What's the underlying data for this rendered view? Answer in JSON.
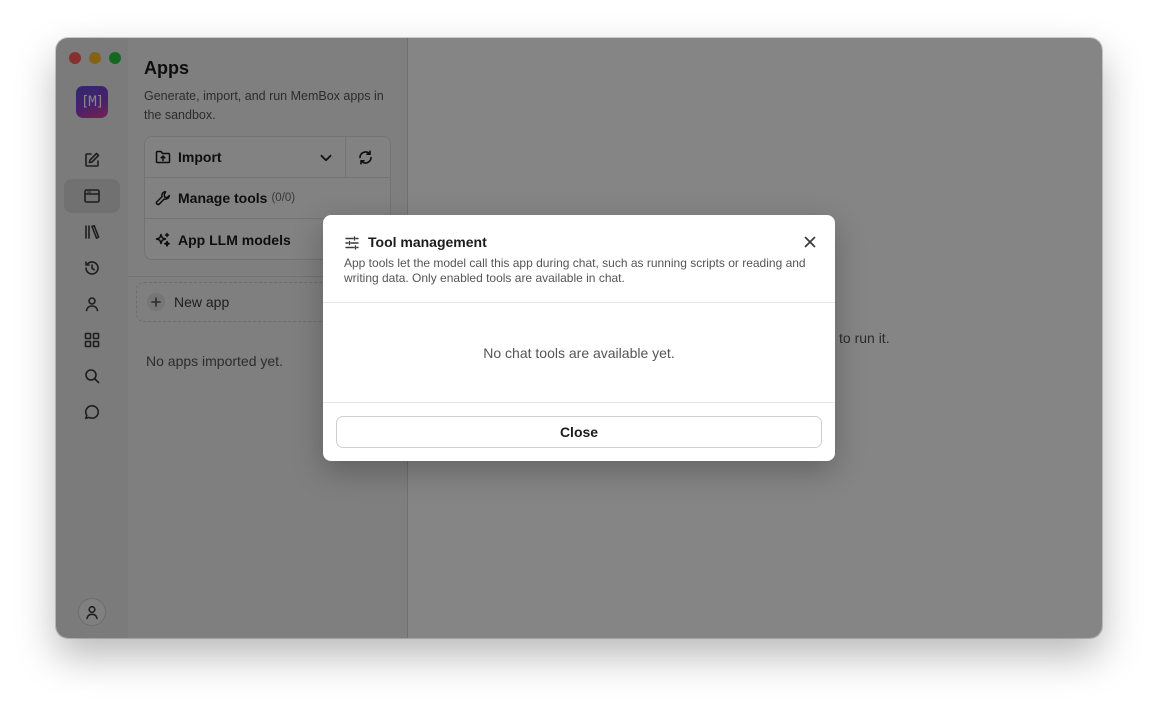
{
  "rail": {
    "logo_text": "[M]",
    "items": [
      {
        "icon": "compose-icon",
        "name": "rail-item-new-chat"
      },
      {
        "icon": "browser-window-icon",
        "name": "rail-item-apps",
        "active": true
      },
      {
        "icon": "library-icon",
        "name": "rail-item-library"
      },
      {
        "icon": "history-icon",
        "name": "rail-item-history"
      },
      {
        "icon": "person-icon",
        "name": "rail-item-contacts"
      },
      {
        "icon": "grid-icon",
        "name": "rail-item-grid"
      },
      {
        "icon": "search-icon",
        "name": "rail-item-search"
      },
      {
        "icon": "chat-bubble-icon",
        "name": "rail-item-chat"
      }
    ],
    "profile_icon": "user-profile-icon"
  },
  "panel": {
    "title": "Apps",
    "description": "Generate, import, and run MemBox apps in the sandbox.",
    "import_label": "Import",
    "manage_tools_label": "Manage tools",
    "manage_tools_count": "(0/0)",
    "llm_models_label": "App LLM models",
    "new_app_label": "New app",
    "empty_text": "No apps imported yet."
  },
  "main": {
    "hint_visible_fragment": "to run it."
  },
  "modal": {
    "title": "Tool management",
    "description": "App tools let the model call this app during chat, such as running scripts or reading and writing data. Only enabled tools are available in chat.",
    "empty_text": "No chat tools are available yet.",
    "close_label": "Close"
  },
  "colors": {
    "overlay": "rgba(0,0,0,0.48)",
    "logo_gradient_start": "#5f4bd6",
    "logo_gradient_end": "#e0428f",
    "traffic_red": "#ff5f57",
    "traffic_yellow": "#febc2e",
    "traffic_green": "#28c840"
  }
}
